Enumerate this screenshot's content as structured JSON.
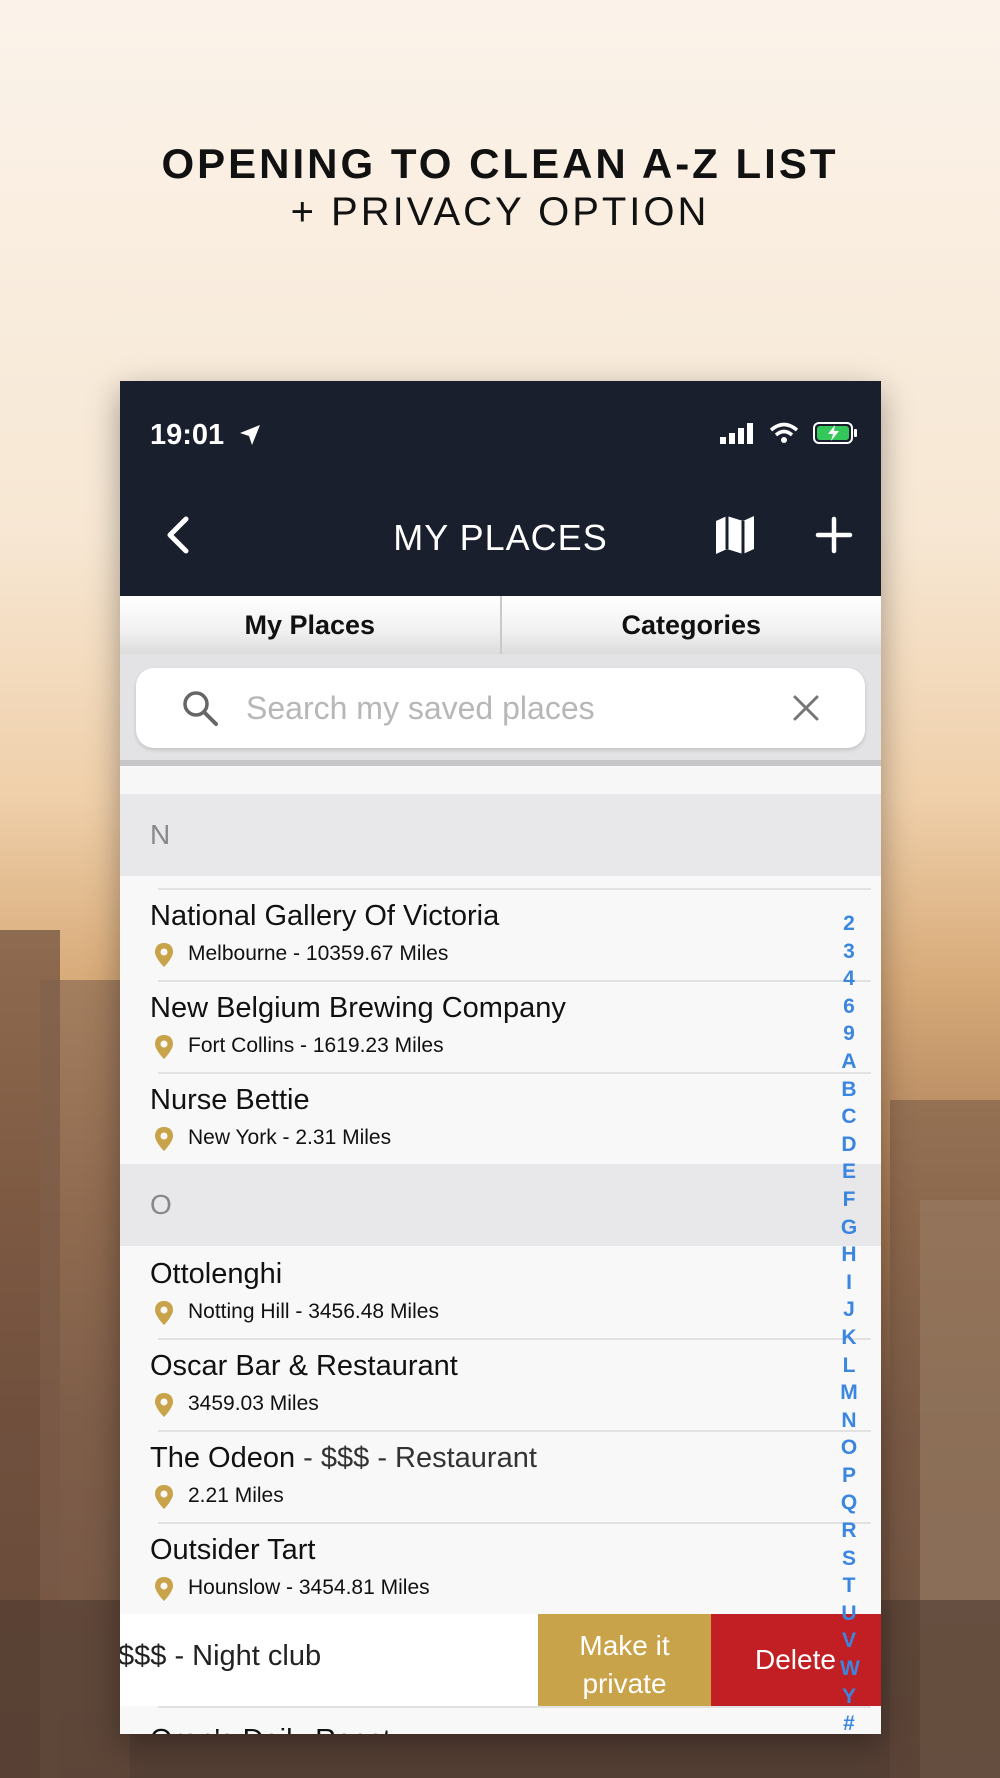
{
  "promo": {
    "line1": "OPENING TO CLEAN A-Z LIST",
    "line2": "+ PRIVACY OPTION"
  },
  "status": {
    "time": "19:01"
  },
  "nav": {
    "title": "MY PLACES",
    "back_icon": "chevron-left-icon",
    "map_icon": "map-icon",
    "add_icon": "plus-icon"
  },
  "tabs": [
    {
      "label": "My Places"
    },
    {
      "label": "Categories"
    }
  ],
  "search": {
    "placeholder": "Search my saved places",
    "value": ""
  },
  "sections": [
    {
      "letter": "N",
      "items": [
        {
          "name": "National Gallery Of Victoria",
          "extra": "",
          "meta": "Melbourne - 10359.67 Miles"
        },
        {
          "name": "New Belgium Brewing Company",
          "extra": "",
          "meta": "Fort Collins - 1619.23 Miles"
        },
        {
          "name": "Nurse Bettie",
          "extra": "",
          "meta": "New York - 2.31 Miles"
        }
      ]
    },
    {
      "letter": "O",
      "items": [
        {
          "name": "Ottolenghi",
          "extra": "",
          "meta": "Notting Hill - 3456.48 Miles"
        },
        {
          "name": "Oscar Bar & Restaurant",
          "extra": "",
          "meta": "3459.03 Miles"
        },
        {
          "name": "The Odeon",
          "extra": " - $$$ - Restaurant",
          "meta": "2.21 Miles"
        },
        {
          "name": "Outsider Tart",
          "extra": "",
          "meta": "Hounslow - 3454.81 Miles"
        }
      ]
    }
  ],
  "swipe_row": {
    "text": "$$$ - Night club",
    "private_line1": "Make it",
    "private_line2": "private",
    "delete_label": "Delete"
  },
  "cut_row": {
    "name": "Oren's Daily Roast"
  },
  "alpha_index": [
    "2",
    "3",
    "4",
    "6",
    "9",
    "A",
    "B",
    "C",
    "D",
    "E",
    "F",
    "G",
    "H",
    "I",
    "J",
    "K",
    "L",
    "M",
    "N",
    "O",
    "P",
    "Q",
    "R",
    "S",
    "T",
    "U",
    "V",
    "W",
    "Y",
    "#"
  ],
  "colors": {
    "navbar": "#1a1f2e",
    "pin": "#c9a34a",
    "delete": "#c21f24",
    "private": "#c9a34a",
    "index": "#3a86e0"
  }
}
